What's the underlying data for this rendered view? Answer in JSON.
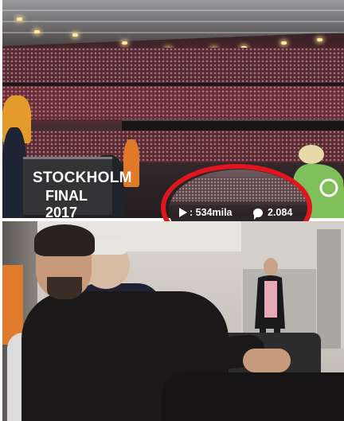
{
  "photo_top": {
    "sign_line1": "STOCKHOLM",
    "sign_line2": "FINAL 2017"
  },
  "video_overlay": {
    "views_icon": "play-icon",
    "views_text": ": 534mila",
    "comments_icon": "comment-icon",
    "comments_text": "2.084",
    "highlight_color": "#e0161d"
  },
  "photo_bottom": {
    "description_icon": "none"
  }
}
